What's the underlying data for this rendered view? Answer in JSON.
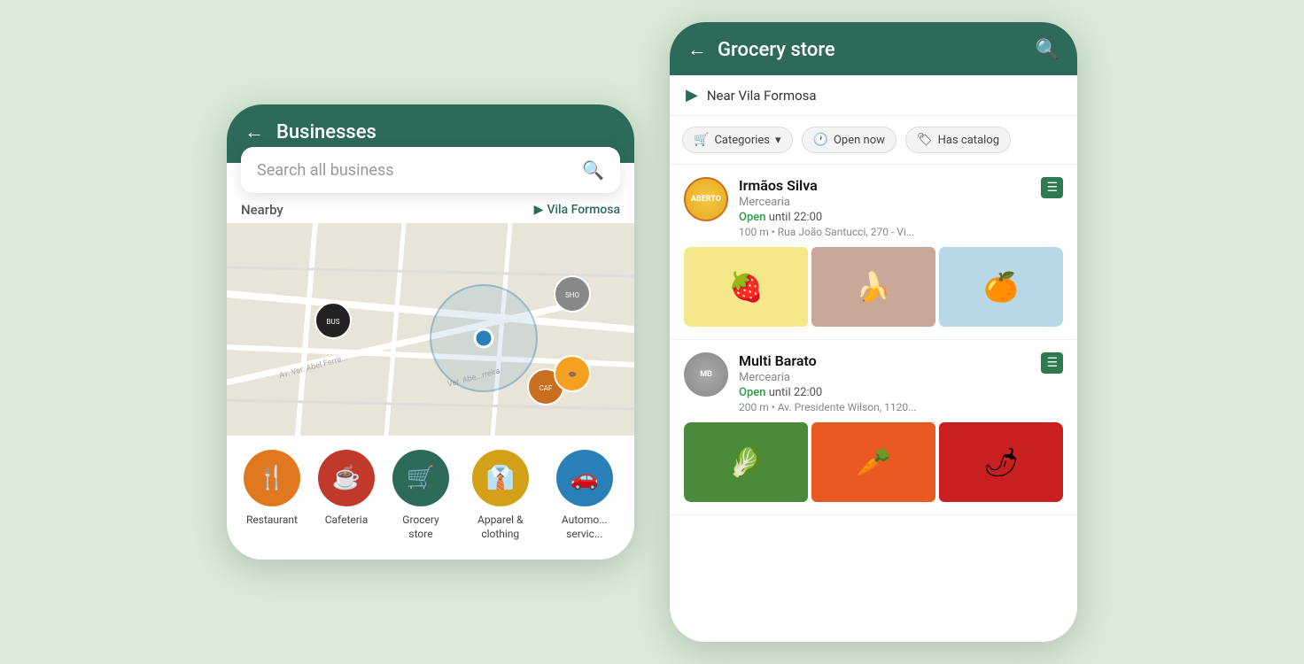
{
  "app": {
    "background_color": "#d8ead8"
  },
  "left_phone": {
    "header": {
      "title": "Businesses",
      "back_label": "←"
    },
    "search": {
      "placeholder": "Search all business",
      "icon": "🔍"
    },
    "map": {
      "nearby_label": "Nearby",
      "location_label": "Vila Formosa",
      "location_icon": "▶"
    },
    "categories": [
      {
        "id": "restaurant",
        "label": "Restaurant",
        "icon": "🍴",
        "color_class": "cat-orange"
      },
      {
        "id": "cafeteria",
        "label": "Cafeteria",
        "icon": "☕",
        "color_class": "cat-red"
      },
      {
        "id": "grocery",
        "label": "Grocery store",
        "icon": "🛒",
        "color_class": "cat-green"
      },
      {
        "id": "apparel",
        "label": "Apparel & clothing",
        "icon": "👕",
        "color_class": "cat-yellow"
      },
      {
        "id": "auto",
        "label": "Automo... servic...",
        "icon": "🚗",
        "color_class": "cat-blue"
      }
    ]
  },
  "right_phone": {
    "header": {
      "title": "Grocery store",
      "back_label": "←",
      "search_icon": "🔍"
    },
    "location_bar": {
      "icon": "▶",
      "text": "Near Vila Formosa"
    },
    "filters": [
      {
        "id": "categories",
        "label": "Categories",
        "icon": "🛒",
        "has_arrow": true
      },
      {
        "id": "open-now",
        "label": "Open now",
        "icon": "🕐",
        "has_arrow": false
      },
      {
        "id": "has-catalog",
        "label": "Has catalog",
        "icon": "🏷",
        "has_arrow": false
      }
    ],
    "businesses": [
      {
        "id": "irmaos-silva",
        "name": "Irmãos Silva",
        "type": "Mercearia",
        "status": "Open",
        "hours": "until 22:00",
        "distance": "100 m • Rua João Santucci, 270 - Vi...",
        "logo_text": "ABERTO",
        "logo_type": "aberto",
        "products": [
          {
            "id": "strawberry",
            "emoji": "🍓",
            "color": "#f5e88a"
          },
          {
            "id": "banana",
            "emoji": "🍌",
            "color": "#c8a898"
          },
          {
            "id": "orange",
            "emoji": "🍊",
            "color": "#b8d8e8"
          }
        ]
      },
      {
        "id": "multi-barato",
        "name": "Multi Barato",
        "type": "Mercearia",
        "status": "Open",
        "hours": "until 22:00",
        "distance": "200 m • Av. Presidente Wilson, 1120...",
        "logo_text": "MB",
        "logo_type": "multibarato",
        "products": [
          {
            "id": "lettuce",
            "emoji": "🥬",
            "color": "#4a8a3a"
          },
          {
            "id": "carrot",
            "emoji": "🥕",
            "color": "#e85a20"
          },
          {
            "id": "pepper",
            "emoji": "🫑",
            "color": "#c82020"
          }
        ]
      }
    ]
  }
}
